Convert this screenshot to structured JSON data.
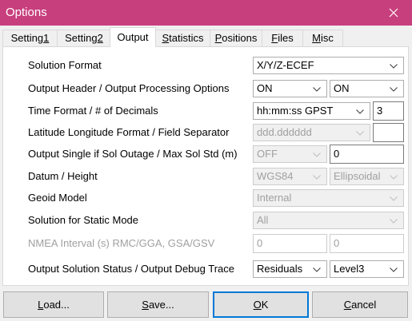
{
  "window": {
    "title": "Options",
    "accent_color": "#c83f7d",
    "focus_color": "#0078d7"
  },
  "icons": {
    "close": "close-icon",
    "dropdown": "chevron-down-icon"
  },
  "tabs": [
    {
      "pre": "Setting",
      "key": "1",
      "post": "",
      "selected": false
    },
    {
      "pre": "Setting",
      "key": "2",
      "post": "",
      "selected": false
    },
    {
      "pre": "Output",
      "key": "",
      "post": "",
      "selected": true
    },
    {
      "pre": "",
      "key": "S",
      "post": "tatistics",
      "selected": false
    },
    {
      "pre": "",
      "key": "P",
      "post": "ositions",
      "selected": false
    },
    {
      "pre": "",
      "key": "F",
      "post": "iles",
      "selected": false
    },
    {
      "pre": "",
      "key": "M",
      "post": "isc",
      "selected": false
    }
  ],
  "rows": [
    {
      "label": "Solution Format",
      "enabled": true,
      "controls": [
        {
          "value": "X/Y/Z-ECEF",
          "enabled": true
        }
      ]
    },
    {
      "label": "Output Header / Output Processing Options",
      "enabled": true,
      "controls": [
        {
          "value": "ON",
          "enabled": true
        },
        {
          "value": "ON",
          "enabled": true
        }
      ]
    },
    {
      "label": "Time Format / # of Decimals",
      "enabled": true,
      "controls": [
        {
          "value": "hh:mm:ss GPST",
          "enabled": true
        },
        {
          "value": "3",
          "enabled": true
        }
      ]
    },
    {
      "label": "Latitude Longitude Format / Field Separator",
      "enabled": true,
      "controls": [
        {
          "value": "ddd.dddddd",
          "enabled": false
        },
        {
          "value": "",
          "enabled": true
        }
      ]
    },
    {
      "label": "Output Single if Sol Outage / Max Sol Std (m)",
      "enabled": true,
      "controls": [
        {
          "value": "OFF",
          "enabled": false
        },
        {
          "value": "0",
          "enabled": true
        }
      ]
    },
    {
      "label": "Datum / Height",
      "enabled": true,
      "controls": [
        {
          "value": "WGS84",
          "enabled": false
        },
        {
          "value": "Ellipsoidal",
          "enabled": false
        }
      ]
    },
    {
      "label": "Geoid Model",
      "enabled": true,
      "controls": [
        {
          "value": "Internal",
          "enabled": false
        }
      ]
    },
    {
      "label": "Solution for Static Mode",
      "enabled": true,
      "controls": [
        {
          "value": "All",
          "enabled": false
        }
      ]
    },
    {
      "label": "NMEA Interval (s) RMC/GGA, GSA/GSV",
      "enabled": false,
      "controls": [
        {
          "value": "0",
          "enabled": false
        },
        {
          "value": "0",
          "enabled": false
        }
      ]
    },
    {
      "label": "Output Solution Status / Output Debug Trace",
      "enabled": true,
      "controls": [
        {
          "value": "Residuals",
          "enabled": true
        },
        {
          "value": "Level3",
          "enabled": true
        }
      ]
    }
  ],
  "buttons": [
    {
      "pre": "",
      "key": "L",
      "post": "oad...",
      "default": false
    },
    {
      "pre": "",
      "key": "S",
      "post": "ave...",
      "default": false
    },
    {
      "pre": "",
      "key": "O",
      "post": "K",
      "default": true
    },
    {
      "pre": "",
      "key": "C",
      "post": "ancel",
      "default": false
    }
  ]
}
